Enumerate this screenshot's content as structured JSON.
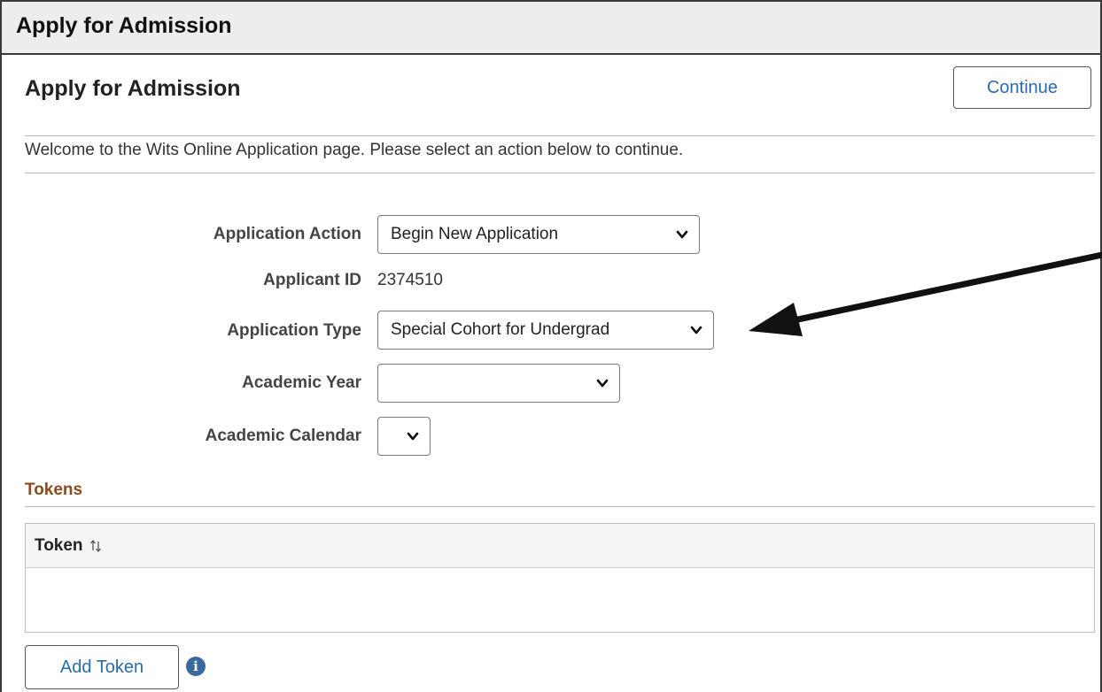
{
  "window": {
    "title": "Apply for Admission"
  },
  "header": {
    "title": "Apply for Admission",
    "continue_label": "Continue"
  },
  "intro": {
    "welcome_text": "Welcome to the Wits Online Application page. Please select an action below to continue."
  },
  "form": {
    "application_action": {
      "label": "Application Action",
      "value": "Begin New Application"
    },
    "applicant_id": {
      "label": "Applicant ID",
      "value": "2374510"
    },
    "application_type": {
      "label": "Application Type",
      "value": "Special Cohort for Undergrad"
    },
    "academic_year": {
      "label": "Academic Year",
      "value": ""
    },
    "academic_calendar": {
      "label": "Academic Calendar",
      "value": ""
    }
  },
  "tokens": {
    "heading": "Tokens",
    "columns": [
      "Token"
    ],
    "rows": [],
    "add_label": "Add Token"
  },
  "colors": {
    "link_blue": "#2a6aad",
    "section_brown": "#8a4b1e",
    "info_blue": "#3b6aa0"
  },
  "icons": [
    "chevron-down-icon",
    "sort-icon",
    "info-icon",
    "annotation-arrow"
  ]
}
